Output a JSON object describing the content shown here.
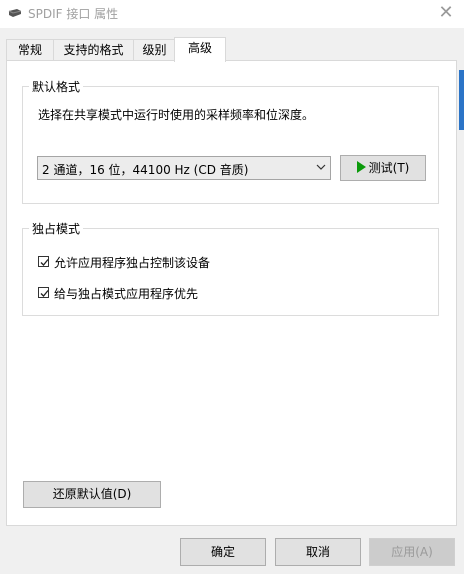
{
  "window": {
    "title": "SPDIF 接口 属性",
    "close_glyph": "✕"
  },
  "tabs": [
    {
      "label": "常规"
    },
    {
      "label": "支持的格式"
    },
    {
      "label": "级别"
    },
    {
      "label": "高级"
    }
  ],
  "default_format": {
    "title": "默认格式",
    "description": "选择在共享模式中运行时使用的采样频率和位深度。",
    "selected_value": "2 通道，16 位，44100 Hz (CD 音质)",
    "test_button": "测试(T)"
  },
  "exclusive_mode": {
    "title": "独占模式",
    "options": [
      {
        "label": "允许应用程序独占控制该设备",
        "checked": true
      },
      {
        "label": "给与独占模式应用程序优先",
        "checked": true
      }
    ]
  },
  "buttons": {
    "restore_defaults": "还原默认值(D)",
    "ok": "确定",
    "cancel": "取消",
    "apply": "应用(A)"
  },
  "colors": {
    "accent": "#2b74c7",
    "play": "#0b9a0b"
  }
}
